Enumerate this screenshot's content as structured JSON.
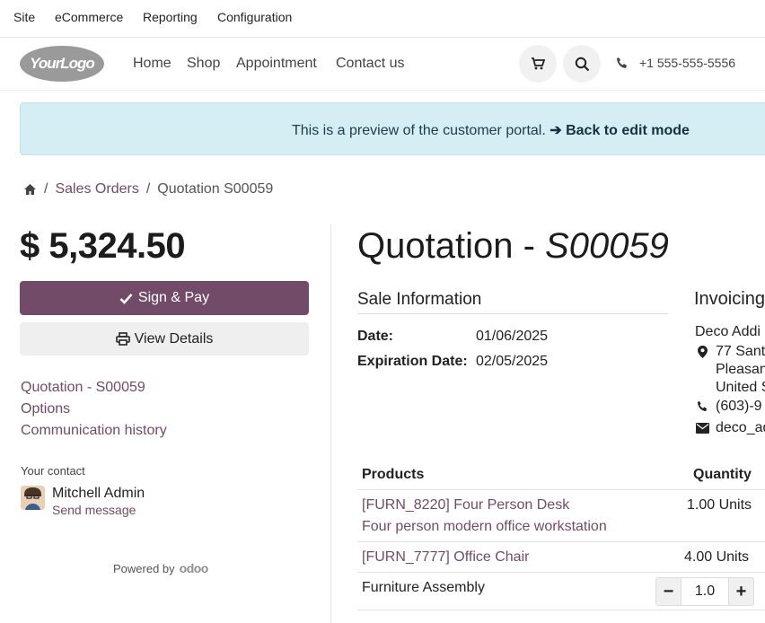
{
  "topbar": {
    "items": [
      "Site",
      "eCommerce",
      "Reporting",
      "Configuration"
    ]
  },
  "header": {
    "logo_text": "YourLogo",
    "nav": [
      "Home",
      "Shop",
      "Appointment",
      "Contact us"
    ],
    "phone": "+1 555-555-5556"
  },
  "banner": {
    "text": "This is a preview of the customer portal.",
    "link": "Back to edit mode"
  },
  "breadcrumb": {
    "sales_orders": "Sales Orders",
    "current": "Quotation S00059"
  },
  "sidebar": {
    "amount": "$ 5,324.50",
    "sign_pay": "Sign & Pay",
    "view_details": "View Details",
    "links": [
      "Quotation - S00059",
      "Options",
      "Communication history"
    ],
    "contact_label": "Your contact",
    "contact_name": "Mitchell Admin",
    "send_message": "Send message",
    "powered_by": "Powered by",
    "odoo": "odoo"
  },
  "main": {
    "title_prefix": "Quotation - ",
    "title_id": "S00059",
    "sale_info_title": "Sale Information",
    "invoicing_title": "Invoicing",
    "date_label": "Date:",
    "date_value": "01/06/2025",
    "exp_label": "Expiration Date:",
    "exp_value": "02/05/2025",
    "invoice_lines": [
      "Deco Addi",
      "77 Sant",
      "Pleasan",
      "United S",
      "(603)-9",
      "deco_ad"
    ],
    "products_header": "Products",
    "quantity_header": "Quantity",
    "products": [
      {
        "name": "[FURN_8220] Four Person Desk",
        "desc": "Four person modern office workstation",
        "qty": "1.00 Units"
      },
      {
        "name": "[FURN_7777] Office Chair",
        "qty": "4.00 Units"
      },
      {
        "name": "Furniture Assembly",
        "qty": "1.0"
      }
    ]
  }
}
